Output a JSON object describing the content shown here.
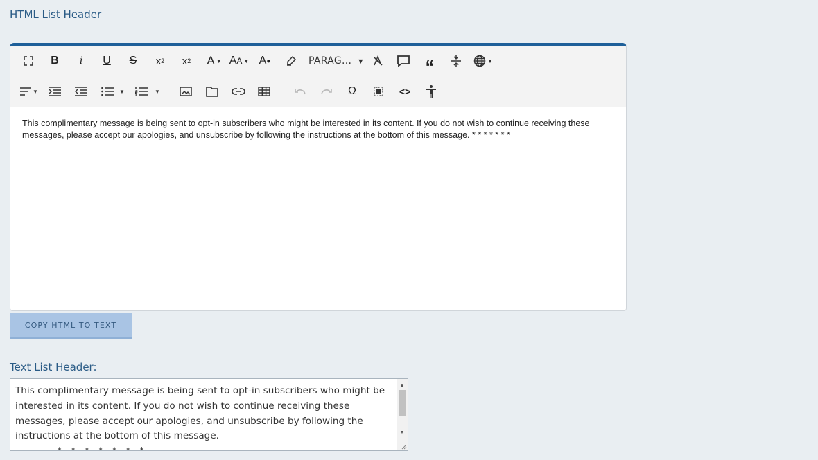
{
  "html_header": {
    "label": "HTML List Header"
  },
  "toolbar": {
    "row1": [
      {
        "name": "fullscreen-icon"
      },
      {
        "name": "bold-icon",
        "glyph": "B"
      },
      {
        "name": "italic-icon",
        "glyph": "i"
      },
      {
        "name": "underline-icon",
        "glyph": "U"
      },
      {
        "name": "strikethrough-icon",
        "glyph": "S"
      },
      {
        "name": "subscript-icon"
      },
      {
        "name": "superscript-icon"
      },
      {
        "name": "font-color-icon",
        "glyph": "A"
      },
      {
        "name": "font-size-icon",
        "glyph": "AA"
      },
      {
        "name": "background-color-icon"
      },
      {
        "name": "highlighter-icon"
      },
      {
        "name": "paragraph-format-dropdown",
        "label": "PARAG..."
      },
      {
        "name": "clear-formatting-icon"
      },
      {
        "name": "comment-icon"
      },
      {
        "name": "quote-icon"
      },
      {
        "name": "insert-hr-icon"
      },
      {
        "name": "globe-icon"
      }
    ],
    "row2": [
      {
        "name": "align-icon"
      },
      {
        "name": "indent-icon"
      },
      {
        "name": "outdent-icon"
      },
      {
        "name": "bullet-list-icon"
      },
      {
        "name": "numbered-list-icon"
      },
      {
        "name": "image-icon"
      },
      {
        "name": "folder-icon"
      },
      {
        "name": "link-icon"
      },
      {
        "name": "table-icon"
      },
      {
        "name": "undo-icon"
      },
      {
        "name": "redo-icon"
      },
      {
        "name": "omega-icon",
        "glyph": "Ω"
      },
      {
        "name": "select-all-icon"
      },
      {
        "name": "code-view-icon",
        "glyph": "<>"
      },
      {
        "name": "accessibility-icon"
      }
    ],
    "paragraph_label": "PARAG..."
  },
  "editor": {
    "content": "This complimentary message is being sent to opt-in subscribers who might be interested in its content. If you do not wish to continue receiving these messages, please accept our apologies, and unsubscribe by following the instructions at the bottom of this message. * * * * * * *"
  },
  "copy_button": {
    "label": "COPY HTML TO TEXT"
  },
  "text_header": {
    "label": "Text List Header:",
    "value": "This complimentary message is being sent to opt-in subscribers who might be interested in its content. If you do not wish to continue receiving these messages, please accept our apologies, and unsubscribe by following the instructions at the bottom of this message.\n              *   *   *   *   *   *   *"
  },
  "colors": {
    "background": "#e9eef2",
    "accent": "#1e5f99",
    "label": "#2a5b86",
    "button": "#a9c4e4"
  }
}
